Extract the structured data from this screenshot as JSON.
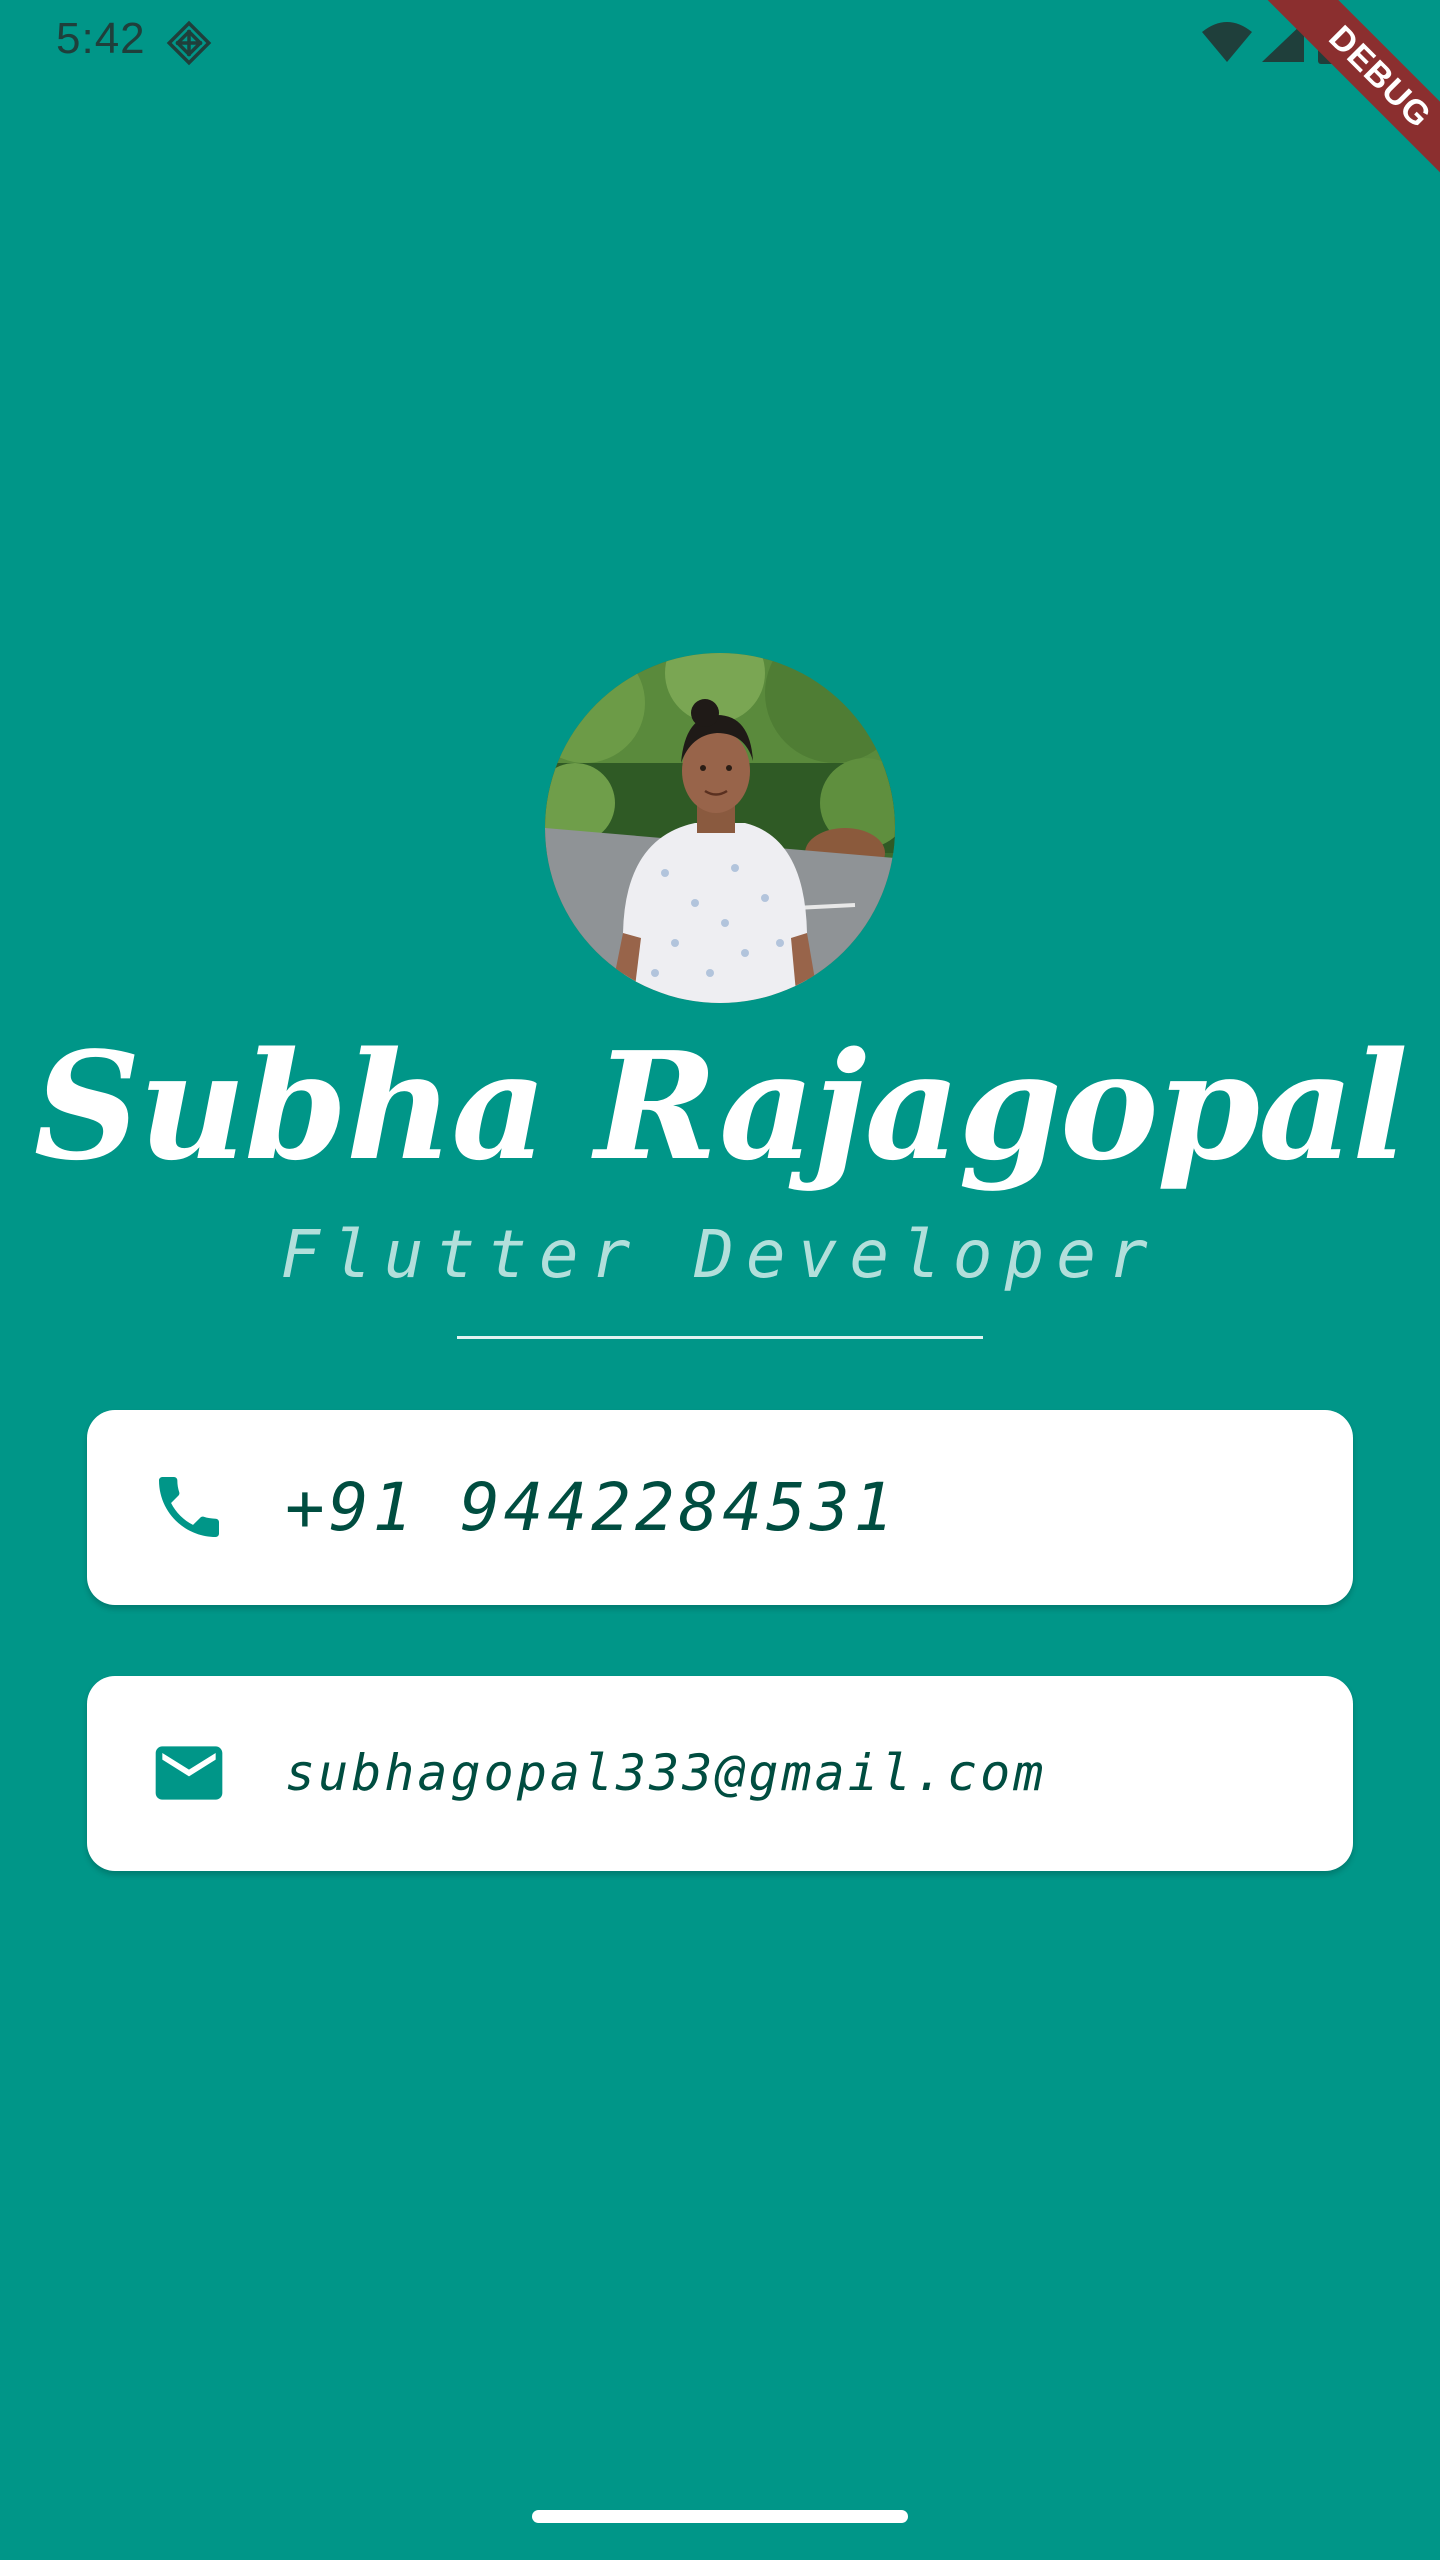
{
  "status_bar": {
    "time": "5:42",
    "app_icon": "app-notification-icon",
    "wifi_icon": "wifi-icon",
    "signal_icon": "cell-signal-icon",
    "battery_icon": "battery-icon"
  },
  "debug_banner": {
    "label": "DEBUG",
    "color": "#8b2f2f"
  },
  "profile": {
    "avatar_icon": "profile-photo",
    "name": "Subha Rajagopal",
    "title": "Flutter Developer"
  },
  "contacts": {
    "phone": {
      "icon": "phone-icon",
      "value": "+91 9442284531"
    },
    "email": {
      "icon": "mail-icon",
      "value": "subhagopal333@gmail.com"
    }
  },
  "colors": {
    "background": "#009688",
    "card": "#ffffff",
    "card_text": "#004d40",
    "icon": "#009688",
    "subtitle": "#b2dfdb"
  }
}
